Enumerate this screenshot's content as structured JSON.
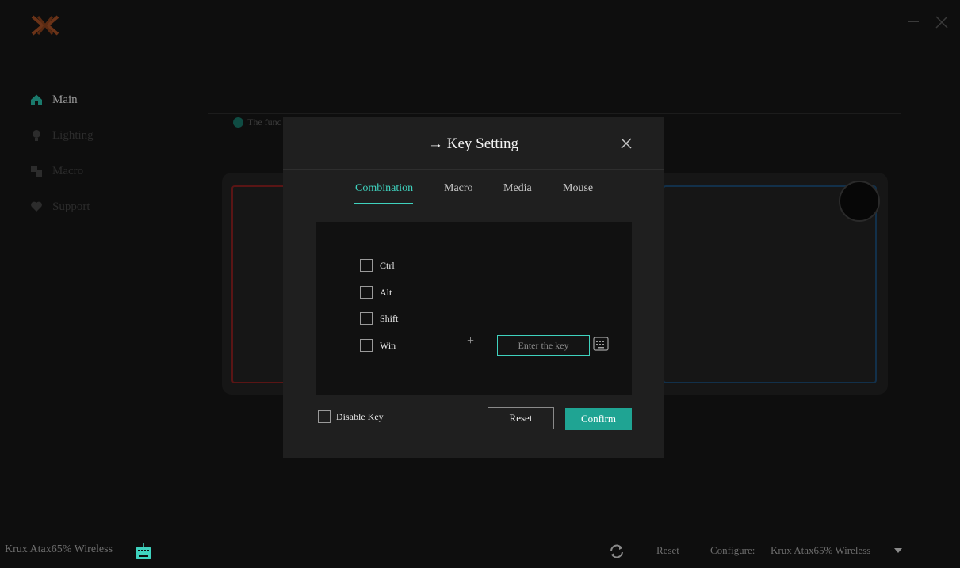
{
  "app": {
    "logo_icon": "x-logo-icon",
    "window_controls": [
      "minimize-icon",
      "close-icon"
    ]
  },
  "sidebar": {
    "items": [
      {
        "label": "Main",
        "icon": "home-icon",
        "active": true
      },
      {
        "label": "Lighting",
        "icon": "bulb-icon",
        "active": false
      },
      {
        "label": "Macro",
        "icon": "macro-icon",
        "active": false
      },
      {
        "label": "Support",
        "icon": "heart-icon",
        "active": false
      }
    ]
  },
  "background": {
    "notice": "The func"
  },
  "modal": {
    "title": "→ Key Setting",
    "tabs": [
      {
        "label": "Combination",
        "active": true
      },
      {
        "label": "Macro",
        "active": false
      },
      {
        "label": "Media",
        "active": false
      },
      {
        "label": "Mouse",
        "active": false
      }
    ],
    "modifiers": [
      "Ctrl",
      "Alt",
      "Shift",
      "Win"
    ],
    "plus": "+",
    "key_input_placeholder": "Enter the key",
    "disable_key_label": "Disable Key",
    "reset_label": "Reset",
    "confirm_label": "Confirm"
  },
  "footer": {
    "device_name": "Krux Atax65% Wireless",
    "reset_label": "Reset",
    "configure_label": "Configure:",
    "configure_value": "Krux Atax65% Wireless"
  },
  "colors": {
    "accent": "#3fd2be",
    "confirm_bg": "#1fa493",
    "modal_bg": "#1f1f1f",
    "page_bg": "#0e0e0e"
  }
}
